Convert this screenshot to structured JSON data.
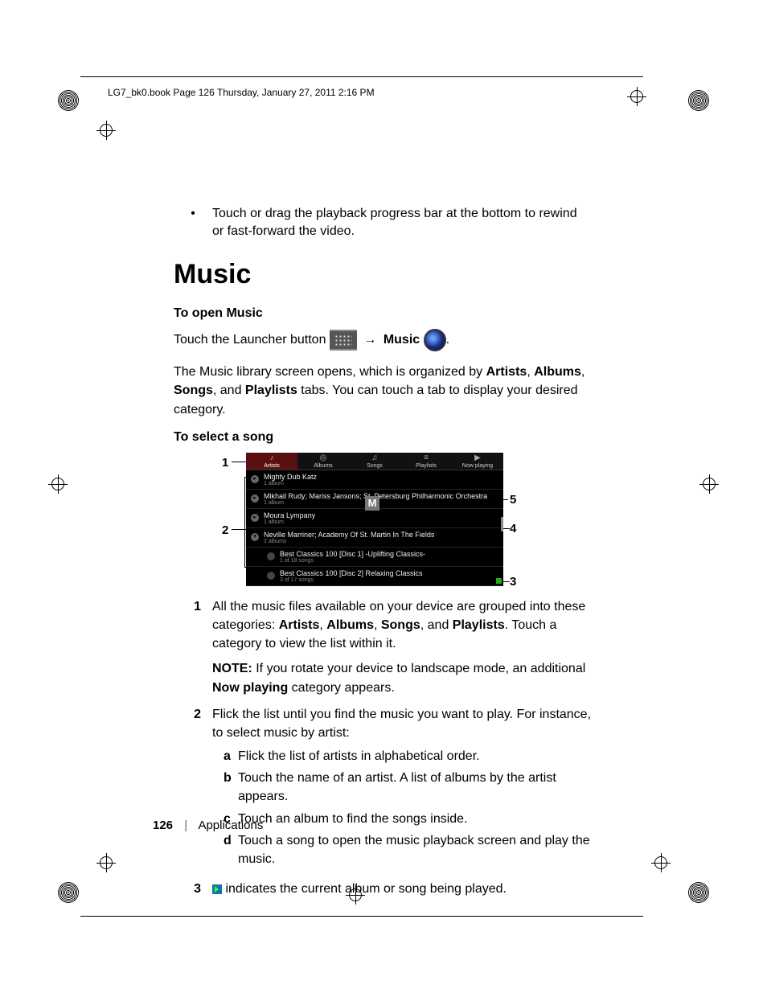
{
  "header": "LG7_bk0.book  Page 126  Thursday, January 27, 2011  2:16 PM",
  "bullet_intro": "Touch or drag the playback progress bar at the bottom to rewind or fast-forward the video.",
  "section_title": "Music",
  "open_music_head": "To open Music",
  "open_music": {
    "prefix": "Touch the Launcher button ",
    "arrow": "→",
    "music_label": "Music",
    "suffix": "."
  },
  "library_para_parts": {
    "a": "The Music library screen opens, which is organized by ",
    "artists": "Artists",
    "c1": ", ",
    "albums": "Albums",
    "c2": ", ",
    "songs": "Songs",
    "c3": ", and ",
    "playlists": "Playlists",
    "d": " tabs. You can touch a tab to display your desired category."
  },
  "select_song_head": "To select a song",
  "screenshot": {
    "tabs": [
      "Artists",
      "Albums",
      "Songs",
      "Playlists",
      "Now playing"
    ],
    "rows": [
      {
        "title": "Mighty Dub Katz",
        "sub": "1 album"
      },
      {
        "title": "Mikhail Rudy; Mariss Jansons; St. Petersburg Philharmonic Orchestra",
        "sub": "1 album"
      },
      {
        "title": "Moura Lympany",
        "sub": "1 album"
      },
      {
        "title": "Neville Marriner; Academy Of St. Martin In The Fields",
        "sub": "2 albums"
      }
    ],
    "subrows": [
      {
        "title": "Best Classics 100 [Disc 1] -Uplifting Classics-",
        "sub": "1 of 18 songs"
      },
      {
        "title": "Best Classics 100 [Disc 2] Relaxing Classics",
        "sub": "3 of 17 songs"
      }
    ],
    "overlay_letter": "M"
  },
  "callouts": {
    "n1": "1",
    "n2": "2",
    "n3": "3",
    "n4": "4",
    "n5": "5"
  },
  "steps": {
    "s1": {
      "num": "1",
      "t1a": "All the music files available on your device are grouped into these categories: ",
      "artists": "Artists",
      "c1": ", ",
      "albums": "Albums",
      "c2": ", ",
      "songs": "Songs",
      "c3": ", and ",
      "playlists": "Playlists",
      "t1b": ". Touch a category to view the list within it.",
      "note_label": "NOTE:",
      "note_a": " If you rotate your device to landscape mode, an additional ",
      "note_bold": "Now playing",
      "note_b": " category appears."
    },
    "s2": {
      "num": "2",
      "lead": "Flick the list until you find the music you want to play. For instance, to select music by artist:",
      "a": {
        "l": "a",
        "t": "Flick the list of artists in alphabetical order."
      },
      "b": {
        "l": "b",
        "t": "Touch the name of an artist. A list of albums by the artist appears."
      },
      "c": {
        "l": "c",
        "t": "Touch an album to find the songs inside."
      },
      "d": {
        "l": "d",
        "t": "Touch a song to open the music playback screen and play the music."
      }
    },
    "s3": {
      "num": "3",
      "t": " indicates the current album or song being played."
    }
  },
  "footer": {
    "page": "126",
    "section": "Applications"
  }
}
